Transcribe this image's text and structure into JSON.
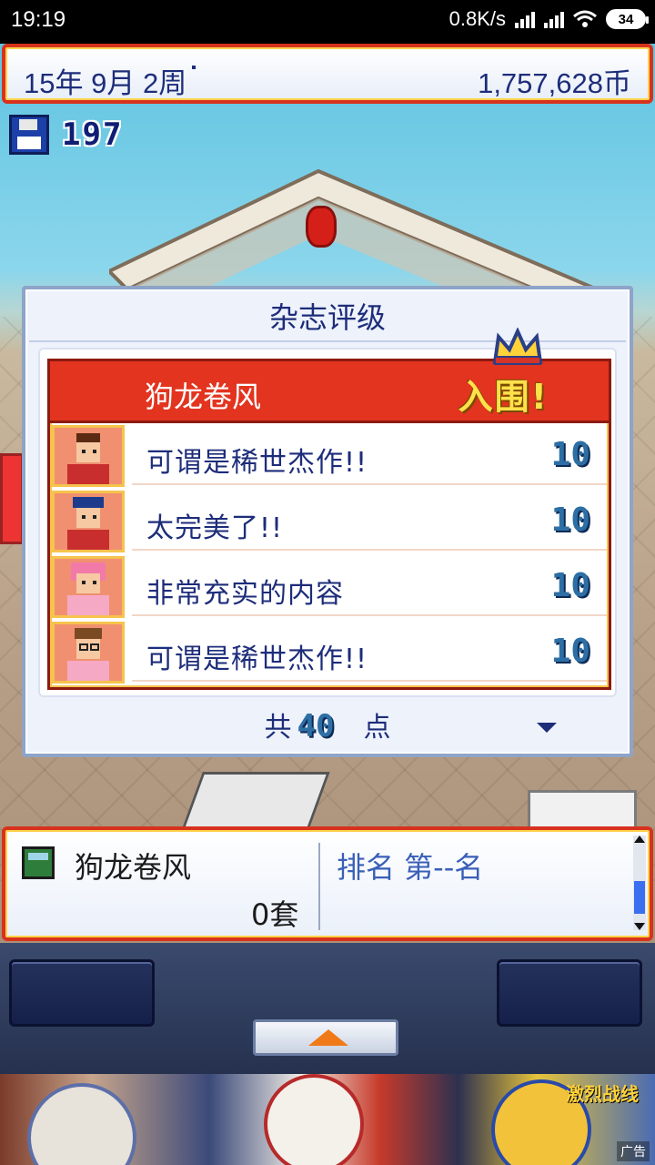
{
  "status_bar": {
    "time": "19:19",
    "network_speed": "0.8K/s",
    "battery": "34"
  },
  "top_bar": {
    "date": "15年 9月 2周",
    "money": "1,757,628币"
  },
  "save": {
    "count": "197"
  },
  "dialog": {
    "title": "杂志评级",
    "game_title": "狗龙卷风",
    "badge": "入围!",
    "reviews": [
      {
        "comment": "可谓是稀世杰作!!",
        "score": "10",
        "reviewer_icon": "reviewer-man-red-icon"
      },
      {
        "comment": "太完美了!!",
        "score": "10",
        "reviewer_icon": "reviewer-cap-man-icon"
      },
      {
        "comment": "非常充实的内容",
        "score": "10",
        "reviewer_icon": "reviewer-pink-hair-woman-icon"
      },
      {
        "comment": "可谓是稀世杰作!!",
        "score": "10",
        "reviewer_icon": "reviewer-glasses-man-icon"
      }
    ],
    "total_prefix": "共",
    "total_value": "40",
    "total_unit": "点"
  },
  "info_panel": {
    "game_name": "狗龙卷风",
    "sets": "0套",
    "rank": "排名 第--名"
  },
  "ad": {
    "logo": "激烈战线",
    "tag": "广告"
  },
  "colors": {
    "frame_red": "#d7321d",
    "text_navy": "#1d2d7a",
    "score_blue": "#2d6fa5",
    "badge_yellow": "#ffe14a"
  }
}
